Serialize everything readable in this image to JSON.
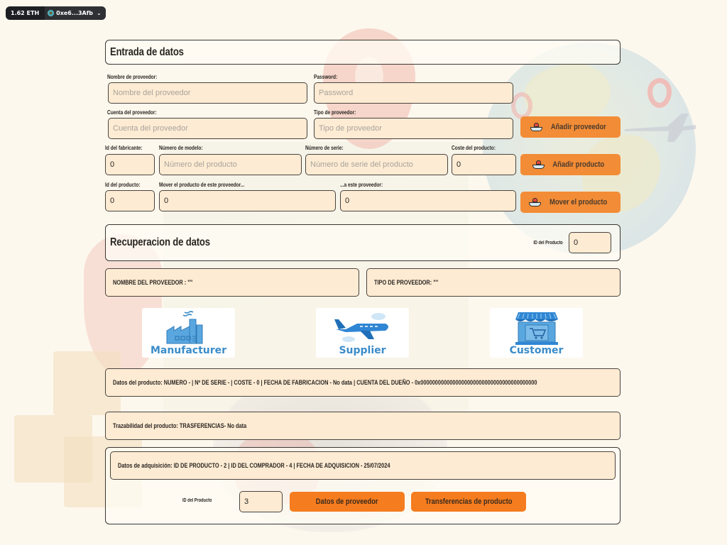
{
  "wallet": {
    "balance": "1.62 ETH",
    "account": "0xe6...3Afb"
  },
  "entrada": {
    "title": "Entrada de datos",
    "nombre_label": "Nombre de proveedor:",
    "nombre_placeholder": "Nombre del proveedor",
    "nombre_value": "",
    "password_label": "Password:",
    "password_placeholder": "Password",
    "password_value": "",
    "cuenta_label": "Cuenta del proveedor:",
    "cuenta_placeholder": "Cuenta del proveedor",
    "cuenta_value": "",
    "tipo_label": "Tipo de proveedor:",
    "tipo_placeholder": "Tipo de proveedor",
    "tipo_value": "",
    "add_supplier_button": "Añadir proveedor",
    "fabricante_label": "Id del fabricante:",
    "fabricante_value": "0",
    "modelo_label": "Número de modelo:",
    "modelo_placeholder": "Número del producto",
    "modelo_value": "",
    "serie_label": "Número de serie:",
    "serie_placeholder": "Número de serie del producto",
    "serie_value": "",
    "coste_label": "Coste del producto:",
    "coste_value": "0",
    "add_product_button": "Añadir producto",
    "id_producto_label": "Id del producto:",
    "id_producto_value": "0",
    "mover_desde_label": "Mover el producto de este proveedor...",
    "mover_desde_value": "0",
    "mover_hasta_label": "...a este proveedor:",
    "mover_hasta_value": "0",
    "move_product_button": "Mover el producto"
  },
  "recuperacion": {
    "title": "Recuperacion de datos",
    "id_label": "ID del Producto",
    "id_value": "0",
    "nombre_proveedor": "NOMBRE DEL PROVEEDOR : \"\"",
    "tipo_proveedor": "TIPO DE PROVEEDOR: \"\""
  },
  "roles": [
    {
      "label": "Manufacturer",
      "icon": "factory-icon"
    },
    {
      "label": "Supplier",
      "icon": "airplane-icon"
    },
    {
      "label": "Customer",
      "icon": "shop-cart-icon"
    }
  ],
  "producto": {
    "datos": "Datos del producto: NUMERO -  |  Nº DE SERIE -  |  COSTE - 0  | FECHA DE FABRICACION - No data  |  CUENTA DEL DUEÑO - 0x0000000000000000000000000000000000000000",
    "trazabilidad": "Trazabilidad del producto: TRASFERENCIAS- No data"
  },
  "adquisicion": {
    "datos": "Datos de adquisición: ID DE PRODUCTO - 2  |  ID DEL COMPRADOR - 4  |  FECHA DE ADQUISICION - 25/07/2024",
    "id_label": "ID del Producto",
    "id_value": "3",
    "supplier_data_button": "Datos de proveedor",
    "transfers_button": "Transferencias de producto"
  },
  "colors": {
    "background": "#fdf8ee",
    "input_bg": "#fdebd3",
    "button_orange": "#f28c36",
    "button_orange_strong": "#f57c1f",
    "role_blue": "#3a8cc9"
  }
}
